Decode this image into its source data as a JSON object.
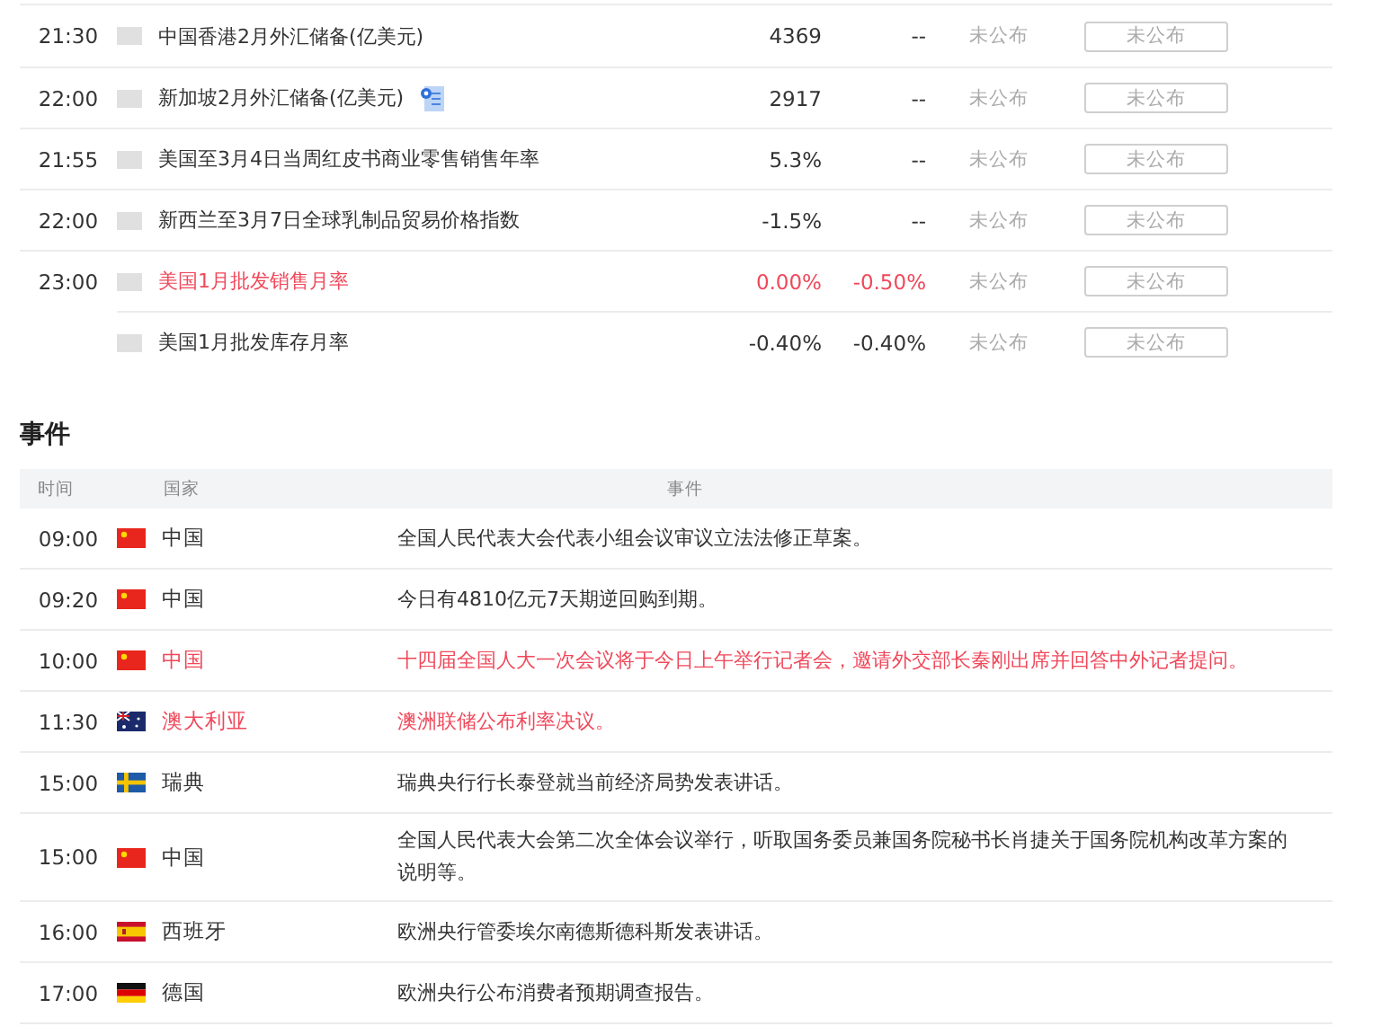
{
  "indicators": [
    {
      "time": "21:30",
      "name": "中国香港2月外汇储备(亿美元)",
      "important": false,
      "previous": "4369",
      "forecast": "--",
      "actual": "未公布",
      "button": "未公布"
    },
    {
      "time": "22:00",
      "name": "新加坡2月外汇储备(亿美元)",
      "doc": true,
      "important": false,
      "previous": "2917",
      "forecast": "--",
      "actual": "未公布",
      "button": "未公布"
    },
    {
      "time": "21:55",
      "name": "美国至3月4日当周红皮书商业零售销售年率",
      "important": false,
      "previous": "5.3%",
      "forecast": "--",
      "actual": "未公布",
      "button": "未公布"
    },
    {
      "time": "22:00",
      "name": "新西兰至3月7日全球乳制品贸易价格指数",
      "important": false,
      "previous": "-1.5%",
      "forecast": "--",
      "actual": "未公布",
      "button": "未公布"
    },
    {
      "time": "23:00",
      "name": "美国1月批发销售月率",
      "important": true,
      "previous": "0.00%",
      "forecast": "-0.50%",
      "actual": "未公布",
      "button": "未公布"
    },
    {
      "name": "美国1月批发库存月率",
      "important": false,
      "previous": "-0.40%",
      "forecast": "-0.40%",
      "actual": "未公布",
      "button": "未公布"
    }
  ],
  "events": {
    "title": "事件",
    "columns": [
      "时间",
      "国家",
      "事件"
    ],
    "rows": [
      {
        "time": "09:00",
        "kind": "cn",
        "country": "中国",
        "event": "全国人民代表大会代表小组会议审议立法法修正草案。",
        "important": false
      },
      {
        "time": "09:20",
        "kind": "cn",
        "country": "中国",
        "event": "今日有4810亿元7天期逆回购到期。",
        "important": false
      },
      {
        "time": "10:00",
        "kind": "cn",
        "country": "中国",
        "event": "十四届全国人大一次会议将于今日上午举行记者会，邀请外交部长秦刚出席并回答中外记者提问。",
        "important": true
      },
      {
        "time": "11:30",
        "kind": "au",
        "country": "澳大利亚",
        "event": "澳洲联储公布利率决议。",
        "important": true
      },
      {
        "time": "15:00",
        "kind": "se",
        "country": "瑞典",
        "event": "瑞典央行行长泰登就当前经济局势发表讲话。",
        "important": false
      },
      {
        "time": "15:00",
        "kind": "cn",
        "country": "中国",
        "event": "全国人民代表大会第二次全体会议举行，听取国务委员兼国务院秘书长肖捷关于国务院机构改革方案的说明等。",
        "important": false
      },
      {
        "time": "16:00",
        "kind": "es",
        "country": "西班牙",
        "event": "欧洲央行管委埃尔南德斯德科斯发表讲话。",
        "important": false
      },
      {
        "time": "17:00",
        "kind": "de",
        "country": "德国",
        "event": "欧洲央行公布消费者预期调查报告。",
        "important": false
      }
    ]
  }
}
